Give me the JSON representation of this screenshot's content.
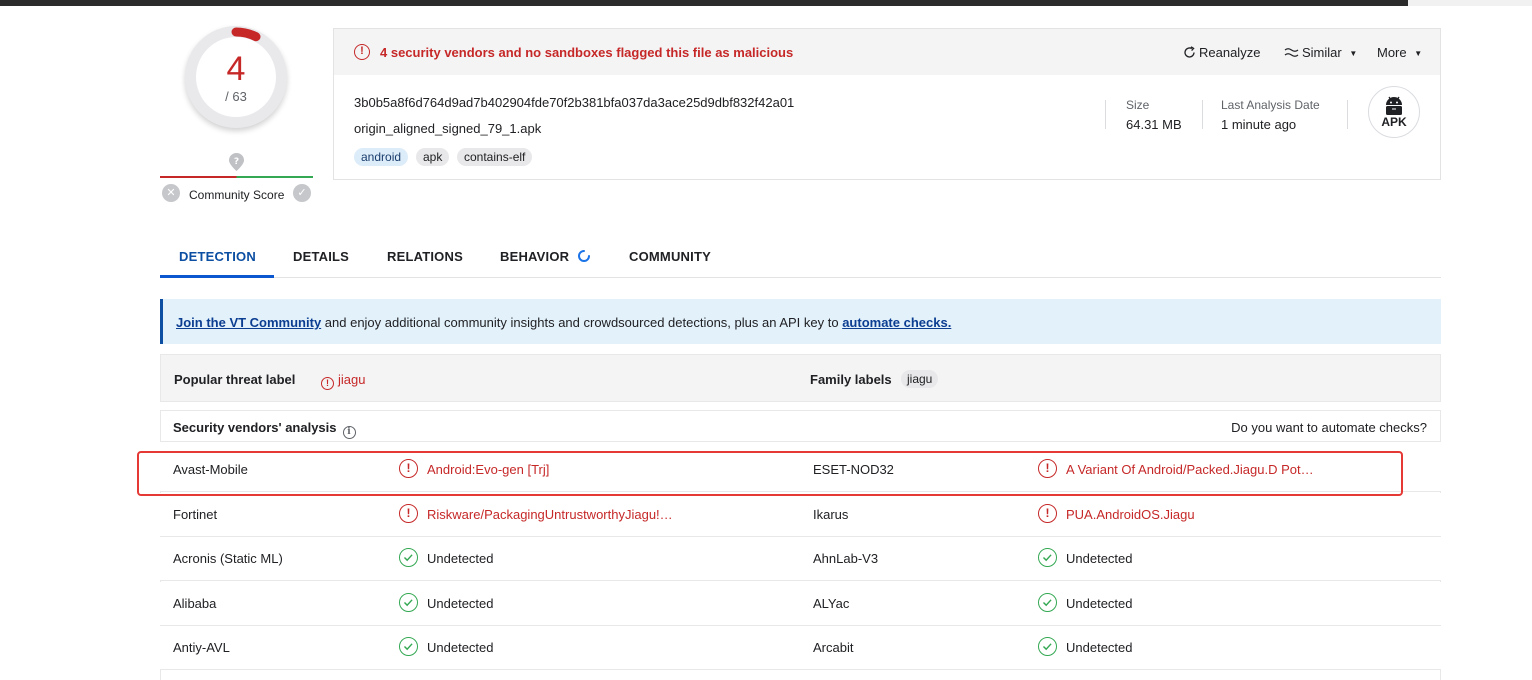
{
  "score": {
    "detections": "4",
    "total": "/ 63"
  },
  "community": {
    "label": "Community Score"
  },
  "summary": {
    "alert": "4 security vendors and no sandboxes flagged this file as malicious",
    "actions": {
      "reanalyze": "Reanalyze",
      "similar": "Similar",
      "more": "More"
    },
    "hash": "3b0b5a8f6d764d9ad7b402904fde70f2b381bfa037da3ace25d9dbf832f42a01",
    "filename": "origin_aligned_signed_79_1.apk",
    "tags": [
      "android",
      "apk",
      "contains-elf"
    ],
    "size_label": "Size",
    "size_value": "64.31 MB",
    "date_label": "Last Analysis Date",
    "date_value": "1 minute ago",
    "filetype": "APK"
  },
  "tabs": [
    "DETECTION",
    "DETAILS",
    "RELATIONS",
    "BEHAVIOR",
    "COMMUNITY"
  ],
  "banner": {
    "link1": "Join the VT Community",
    "middle": " and enjoy additional community insights and crowdsourced detections, plus an API key to ",
    "link2": "automate checks."
  },
  "threat": {
    "popular_label": "Popular threat label",
    "popular_value": "jiagu",
    "family_label": "Family labels",
    "family_value": "jiagu"
  },
  "vendors": {
    "title": "Security vendors' analysis",
    "automate": "Do you want to automate checks?",
    "rows": [
      {
        "l_name": "Avast-Mobile",
        "l_result": "Android:Evo-gen [Trj]",
        "r_name": "ESET-NOD32",
        "r_result": "A Variant Of Android/Packed.Jiagu.D Pot…"
      },
      {
        "l_name": "Fortinet",
        "l_result": "Riskware/PackagingUntrustworthyJiagu!…",
        "r_name": "Ikarus",
        "r_result": "PUA.AndroidOS.Jiagu"
      },
      {
        "l_name": "Acronis (Static ML)",
        "l_result": "Undetected",
        "r_name": "AhnLab-V3",
        "r_result": "Undetected"
      },
      {
        "l_name": "Alibaba",
        "l_result": "Undetected",
        "r_name": "ALYac",
        "r_result": "Undetected"
      },
      {
        "l_name": "Antiy-AVL",
        "l_result": "Undetected",
        "r_name": "Arcabit",
        "r_result": "Undetected"
      }
    ]
  }
}
